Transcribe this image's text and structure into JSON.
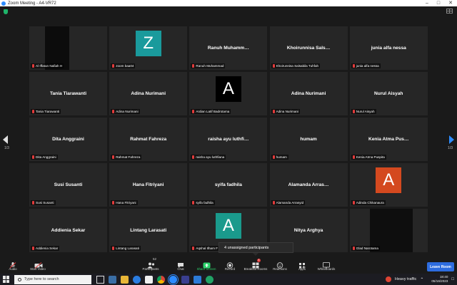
{
  "window": {
    "title": "Zoom Meeting - A4-VR72"
  },
  "page_indicator": {
    "left": "1/3",
    "right": "1/3"
  },
  "tiles": [
    {
      "name": "",
      "label": "Al Iffatun Nafiah H",
      "kind": "video",
      "video_color": "#0c0c0c"
    },
    {
      "name": "",
      "label": "zoom baa04",
      "kind": "avatar",
      "avatar_letter": "Z",
      "avatar_color": "#1a9a9c"
    },
    {
      "name": "Ranuh  Muhamm…",
      "label": "Ranuh Muhammad",
      "kind": "name"
    },
    {
      "name": "Khoirunnisa  Sals…",
      "label": "Khoirunnisa Salsabila Tuhfah",
      "kind": "name"
    },
    {
      "name": "junia alfa nessa",
      "label": "junia alfa nessa",
      "kind": "name"
    },
    {
      "name": "Tania Tiarawanti",
      "label": "Tania Tiarawanti",
      "kind": "name"
    },
    {
      "name": "Adina Nurimani",
      "label": "Adina Nurimani",
      "kind": "name"
    },
    {
      "name": "",
      "label": "Ardian Latif Badrotama",
      "kind": "avatar",
      "avatar_letter": "A",
      "avatar_color": "#000000"
    },
    {
      "name": "Adina Nurimani",
      "label": "Adina Nurimani",
      "kind": "name"
    },
    {
      "name": "Nurul Aisyah",
      "label": "Nurul Aisyah",
      "kind": "name"
    },
    {
      "name": "Dita Anggraini",
      "label": "Dita Anggraini",
      "kind": "name"
    },
    {
      "name": "Rahmat Fahreza",
      "label": "Rahmat Fahreza",
      "kind": "name"
    },
    {
      "name": "raisha ayu luthfi…",
      "label": "raisha ayu luthfiana",
      "kind": "name"
    },
    {
      "name": "humam",
      "label": "humam",
      "kind": "name"
    },
    {
      "name": "Kenia Atma Pus…",
      "label": "Kenia Atma Puspita",
      "kind": "name"
    },
    {
      "name": "Susi Susanti",
      "label": "Susi Susanti",
      "kind": "name"
    },
    {
      "name": "Hana Fitriyani",
      "label": "Hana Fitriyani",
      "kind": "name"
    },
    {
      "name": "syifa fadhila",
      "label": "syifa fadhila",
      "kind": "name"
    },
    {
      "name": "Alamanda  Arras…",
      "label": "Alamanda Arrasyid",
      "kind": "name"
    },
    {
      "name": "",
      "label": "Adinda Chikanaura",
      "kind": "avatar",
      "avatar_letter": "A",
      "avatar_color": "#d4491f"
    },
    {
      "name": "Addienia Sekar",
      "label": "Addienia Sekar",
      "kind": "name"
    },
    {
      "name": "Lintang Larasati",
      "label": "Lintang Larasati",
      "kind": "name"
    },
    {
      "name": "",
      "label": "Aqshal Ilham F",
      "kind": "avatar",
      "avatar_letter": "A",
      "avatar_color": "#1a9a8c"
    },
    {
      "name": "Nitya Arghya",
      "label": "",
      "kind": "name"
    },
    {
      "name": "",
      "label": "Glad Narotama",
      "kind": "video",
      "video_color": "#0e0e0e"
    }
  ],
  "popup": {
    "text": "4 unassigned participants"
  },
  "toolbar": {
    "audio": "Audio",
    "start_video": "Start Video",
    "participants": "Participants",
    "participants_count": "52",
    "chat": "Chat",
    "share_screen": "Share Screen",
    "record": "Record",
    "breakout_rooms": "Breakout Rooms",
    "breakout_badge": "4",
    "reactions": "Reactions",
    "apps": "Apps",
    "whiteboards": "Whiteboards",
    "leave": "Leave Room"
  },
  "taskbar": {
    "search_placeholder": "Type here to search",
    "weather": "Heavy traffic",
    "time": "18:40",
    "date": "05/16/2023"
  },
  "colors": {
    "accent": "#2d8cff",
    "share_green": "#2bd26b",
    "leave_blue": "#2d6cdf",
    "muted_red": "#e23b3b"
  }
}
